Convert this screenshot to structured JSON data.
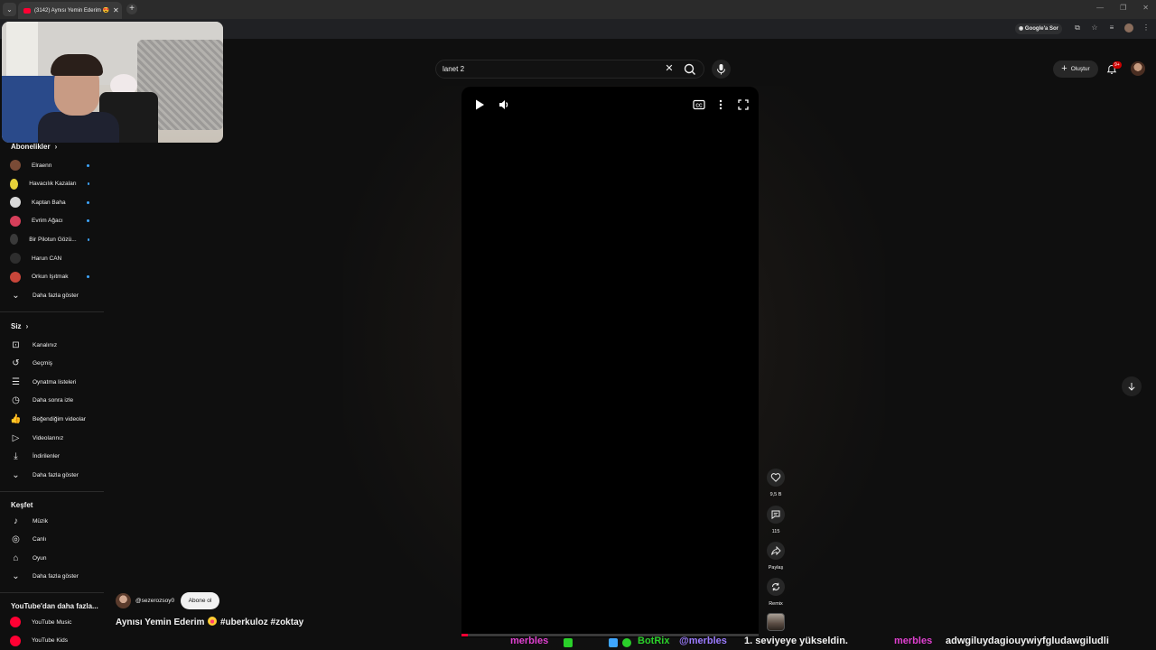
{
  "browser": {
    "tab_title": "(3142) Aynısı Yemin Ederim 😍",
    "tab_close": "✕",
    "new_tab": "+",
    "google_sor": "Google'a Sor"
  },
  "masthead": {
    "search_value": "lanet 2",
    "create_label": "Oluştur",
    "notification_count": "9+"
  },
  "sidebar": {
    "subscriptions_title": "Abonelikler",
    "subscriptions": [
      {
        "label": "Elraenn",
        "color": "#7a4b36",
        "new": true
      },
      {
        "label": "Havacılık Kazaları",
        "color": "#e8d33a",
        "new": true
      },
      {
        "label": "Kaptan Baha",
        "color": "#d8d8d8",
        "new": true
      },
      {
        "label": "Evrim Ağacı",
        "color": "#d63f5a",
        "new": true
      },
      {
        "label": "Bir Pilotun Gözü...",
        "color": "#3a3a3a",
        "new": true
      },
      {
        "label": "Harun CAN",
        "color": "#2e2e2e",
        "new": false
      },
      {
        "label": "Orkun Işıtmak",
        "color": "#c8463a",
        "new": true
      }
    ],
    "subscriptions_more": "Daha fazla göster",
    "you_title": "Siz",
    "you_items": [
      {
        "label": "Kanalınız",
        "icon": "channel-icon"
      },
      {
        "label": "Geçmiş",
        "icon": "history-icon"
      },
      {
        "label": "Oynatma listeleri",
        "icon": "playlists-icon"
      },
      {
        "label": "Daha sonra izle",
        "icon": "watch-later-icon"
      },
      {
        "label": "Beğendiğim videolar",
        "icon": "liked-icon"
      },
      {
        "label": "Videolarınız",
        "icon": "your-videos-icon"
      },
      {
        "label": "İndirilenler",
        "icon": "downloads-icon"
      }
    ],
    "you_more": "Daha fazla göster",
    "explore_title": "Keşfet",
    "explore_items": [
      {
        "label": "Müzik",
        "icon": "music-icon"
      },
      {
        "label": "Canlı",
        "icon": "live-icon"
      },
      {
        "label": "Oyun",
        "icon": "gaming-icon"
      }
    ],
    "explore_more": "Daha fazla göster",
    "more_from_title": "YouTube'dan daha fazla...",
    "more_from_items": [
      {
        "label": "YouTube Music",
        "color": "#ff0033"
      },
      {
        "label": "YouTube Kids",
        "color": "#ff0033"
      }
    ]
  },
  "short": {
    "like_count": "9,5 B",
    "comment_count": "115",
    "share_label": "Paylaş",
    "remix_label": "Remix",
    "channel_handle": "@sezerozsoy0",
    "subscribe_label": "Abone ol",
    "title_part1": "Aynısı Yemin Ederim",
    "title_part2": "#uberkuloz  #zoktay",
    "progress": 0.02
  },
  "chat_overlay": {
    "user1": "merbles",
    "user2": "BotRix",
    "mention": "@merbles",
    "message2": "1. seviyeye yükseldin.",
    "user3": "merbles",
    "message3": "adwgiluydagiouywiyfgludawgiludli"
  },
  "colors": {
    "accent": "#ff0033",
    "chat_user_merbles": "#e040d0",
    "chat_user_botrix": "#2ad02a"
  }
}
